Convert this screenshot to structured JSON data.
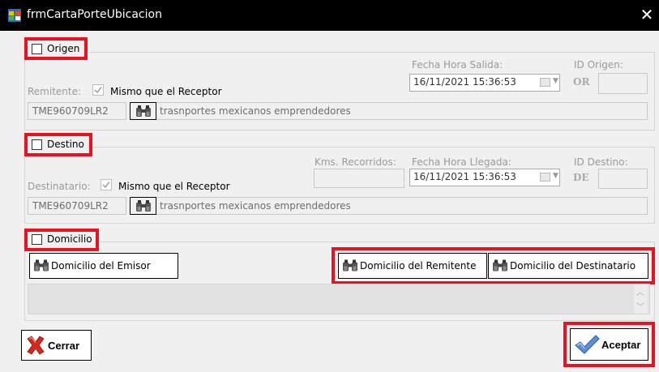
{
  "window": {
    "title": "frmCartaPorteUbicacion",
    "close_icon": "close-icon",
    "app_icon": "form-app-icon"
  },
  "origen": {
    "check_label": "Origen",
    "fecha_label": "Fecha Hora Salida:",
    "fecha_value": "16/11/2021 15:36:53",
    "id_label": "ID Origen:",
    "id_prefix": "OR",
    "id_value": "",
    "remitente_label": "Remitente:",
    "mismo_label": "Mismo que el Receptor",
    "rfc": "TME960709LR2",
    "nombre": "trasnportes mexicanos emprendedores"
  },
  "destino": {
    "check_label": "Destino",
    "kms_label": "Kms. Recorridos:",
    "kms_value": "",
    "fecha_label": "Fecha Hora Llegada:",
    "fecha_value": "16/11/2021 15:36:53",
    "id_label": "ID Destino:",
    "id_prefix": "DE",
    "id_value": "",
    "destinatario_label": "Destinatario:",
    "mismo_label": "Mismo que el Receptor",
    "rfc": "TME960709LR2",
    "nombre": "trasnportes mexicanos emprendedores"
  },
  "domicilio": {
    "check_label": "Domicilio",
    "emisor_button": "Domicilio del Emisor",
    "remitente_button": "Domicilio del Remitente",
    "destinatario_button": "Domicilio del Destinatario",
    "text": ""
  },
  "footer": {
    "cerrar_label": "Cerrar",
    "aceptar_label": "Aceptar"
  },
  "colors": {
    "highlight": "#e8131f",
    "titlebar": "#000000",
    "disabled_text": "#9a9a9a"
  }
}
